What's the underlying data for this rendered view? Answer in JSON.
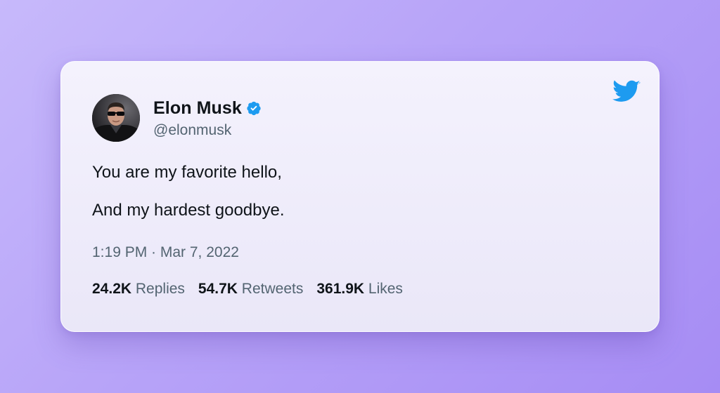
{
  "tweet": {
    "author": {
      "display_name": "Elon Musk",
      "handle": "@elonmusk",
      "verified": true,
      "avatar_icon": "profile-photo"
    },
    "lines": [
      "You are my favorite hello,",
      "And my hardest goodbye."
    ],
    "timestamp": "1:19 PM · Mar 7, 2022",
    "stats": [
      {
        "count": "24.2K",
        "label": "Replies"
      },
      {
        "count": "54.7K",
        "label": "Retweets"
      },
      {
        "count": "361.9K",
        "label": "Likes"
      }
    ]
  },
  "icons": {
    "brand": "twitter-bird-icon",
    "badge": "verified-badge-icon"
  },
  "colors": {
    "brand_blue": "#1d9bf0",
    "text_primary": "#0f1419",
    "text_secondary": "#536471",
    "background_start": "#c7b9fb",
    "background_end": "#a68cf4",
    "card": "#f1effb"
  }
}
